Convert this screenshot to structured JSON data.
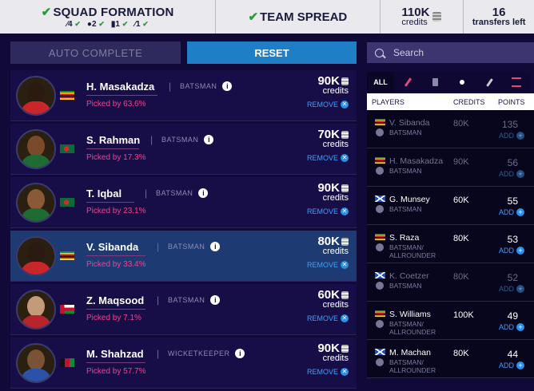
{
  "topbar": {
    "title": "SQUAD FORMATION",
    "counts": [
      {
        "icon": "bat-icon",
        "value": "4"
      },
      {
        "icon": "ball-icon",
        "value": "2"
      },
      {
        "icon": "wicketkeeper-icon",
        "value": "1"
      },
      {
        "icon": "allrounder-icon",
        "value": "1"
      }
    ],
    "team_spread": "TEAM SPREAD",
    "credits_value": "110K",
    "credits_label": "credits",
    "transfers_value": "16",
    "transfers_label": "transfers left"
  },
  "actions": {
    "auto_complete": "AUTO COMPLETE",
    "reset": "RESET"
  },
  "squad": [
    {
      "name": "H. Masakadza",
      "role": "BATSMAN",
      "picked": "Picked by 63.6%",
      "credits": "90K",
      "credits_label": "credits",
      "remove": "REMOVE",
      "flag": "zimbabwe",
      "skin": "#2b1a10",
      "shirt": "#c9262c",
      "highlight": false
    },
    {
      "name": "S. Rahman",
      "role": "BATSMAN",
      "picked": "Picked by 17.3%",
      "credits": "70K",
      "credits_label": "credits",
      "remove": "REMOVE",
      "flag": "bangladesh",
      "skin": "#7a4a2a",
      "shirt": "#1f6b34",
      "highlight": false
    },
    {
      "name": "T. Iqbal",
      "role": "BATSMAN",
      "picked": "Picked by 23.1%",
      "credits": "90K",
      "credits_label": "credits",
      "remove": "REMOVE",
      "flag": "bangladesh",
      "skin": "#8a5a36",
      "shirt": "#1f6b34",
      "highlight": false
    },
    {
      "name": "V. Sibanda",
      "role": "BATSMAN",
      "picked": "Picked by 33.4%",
      "credits": "80K",
      "credits_label": "credits",
      "remove": "REMOVE",
      "flag": "zimbabwe",
      "skin": "#2a1a12",
      "shirt": "#c9262c",
      "highlight": true
    },
    {
      "name": "Z. Maqsood",
      "role": "BATSMAN",
      "picked": "Picked by 7.1%",
      "credits": "60K",
      "credits_label": "credits",
      "remove": "REMOVE",
      "flag": "oman",
      "skin": "#c59a78",
      "shirt": "#b8242c",
      "highlight": false
    },
    {
      "name": "M. Shahzad",
      "role": "WICKETKEEPER",
      "picked": "Picked by 57.7%",
      "credits": "90K",
      "credits_label": "credits",
      "remove": "REMOVE",
      "flag": "afghanistan",
      "skin": "#7a5236",
      "shirt": "#2a52a8",
      "highlight": false
    }
  ],
  "search": {
    "placeholder": "Search"
  },
  "filters": {
    "all": "ALL"
  },
  "table": {
    "headers": {
      "players": "PLAYERS",
      "credits": "CREDITS",
      "points": "POINTS"
    },
    "rows": [
      {
        "name": "V. Sibanda",
        "role": "BATSMAN",
        "credits": "80K",
        "points": "135",
        "add": "ADD",
        "flag": "zimbabwe",
        "dim": true
      },
      {
        "name": "H. Masakadza",
        "role": "BATSMAN",
        "credits": "90K",
        "points": "56",
        "add": "ADD",
        "flag": "zimbabwe",
        "dim": true
      },
      {
        "name": "G. Munsey",
        "role": "BATSMAN",
        "credits": "60K",
        "points": "55",
        "add": "ADD",
        "flag": "scotland",
        "dim": false
      },
      {
        "name": "S. Raza",
        "role": "BATSMAN/\nALLROUNDER",
        "credits": "80K",
        "points": "53",
        "add": "ADD",
        "flag": "zimbabwe",
        "dim": false
      },
      {
        "name": "K. Coetzer",
        "role": "BATSMAN",
        "credits": "80K",
        "points": "52",
        "add": "ADD",
        "flag": "scotland",
        "dim": true
      },
      {
        "name": "S. Williams",
        "role": "BATSMAN/\nALLROUNDER",
        "credits": "100K",
        "points": "49",
        "add": "ADD",
        "flag": "zimbabwe",
        "dim": false
      },
      {
        "name": "M. Machan",
        "role": "BATSMAN/\nALLROUNDER",
        "credits": "80K",
        "points": "44",
        "add": "ADD",
        "flag": "scotland",
        "dim": false
      }
    ]
  },
  "colors": {
    "accent_blue": "#1e7fc6",
    "picked_pink": "#ff3d8b",
    "check_green": "#2a9a3a",
    "bg": "#110a38"
  }
}
